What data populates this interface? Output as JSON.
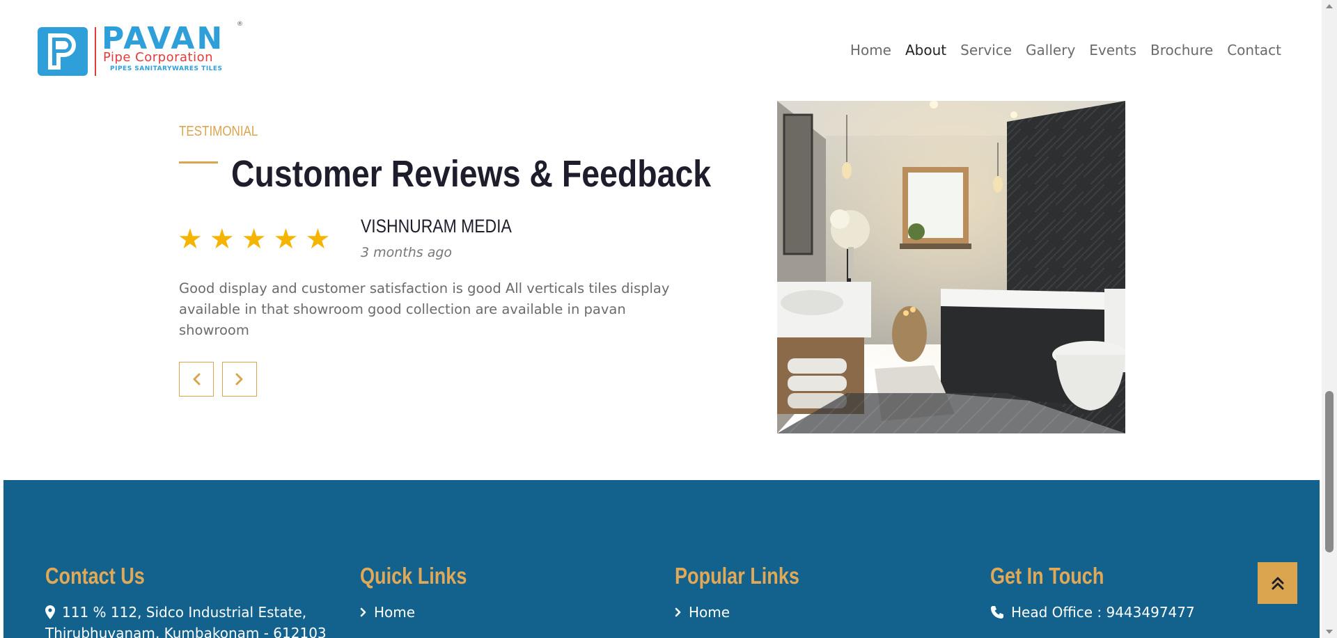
{
  "header": {
    "logo": {
      "letter": "P",
      "name": "PAVAN",
      "reg": "®",
      "subtitle": "Pipe Corporation",
      "tagline": "PIPES  SANITARYWARES  TILES"
    },
    "nav": [
      {
        "label": "Home",
        "active": false
      },
      {
        "label": "About",
        "active": true
      },
      {
        "label": "Service",
        "active": false
      },
      {
        "label": "Gallery",
        "active": false
      },
      {
        "label": "Events",
        "active": false
      },
      {
        "label": "Brochure",
        "active": false
      },
      {
        "label": "Contact",
        "active": false
      }
    ]
  },
  "testimonial": {
    "eyebrow": "TESTIMONIAL",
    "title": "Customer Reviews & Feedback",
    "rating": 5,
    "stars": [
      "★",
      "★",
      "★",
      "★",
      "★"
    ],
    "reviewer": "VISHNURAM MEDIA",
    "time": "3 months ago",
    "text": "Good display and customer satisfaction is good All verticals tiles display available in that showroom good collection are available in pavan showroom",
    "prev_icon": "chevron-left-icon",
    "next_icon": "chevron-right-icon",
    "image_icon": "bathroom-photo"
  },
  "footer": {
    "columns": [
      {
        "heading": "Contact Us",
        "icon": "map-pin-icon",
        "item": "111 % 112, Sidco Industrial Estate,",
        "item2": "Thirubhuvanam, Kumbakonam - 612103"
      },
      {
        "heading": "Quick Links",
        "icon": "chevron-right-icon",
        "item": "Home"
      },
      {
        "heading": "Popular Links",
        "icon": "chevron-right-icon",
        "item": "Home"
      },
      {
        "heading": "Get In Touch",
        "icon": "phone-icon",
        "item": "Head Office : 9443497477"
      }
    ],
    "scroll_top_icon": "double-chevron-up-icon"
  },
  "colors": {
    "accent": "#dba44f",
    "footer_bg": "#13628e",
    "brand_blue": "#2e9fd9",
    "brand_red": "#e23b3b",
    "star": "#f5b400"
  }
}
